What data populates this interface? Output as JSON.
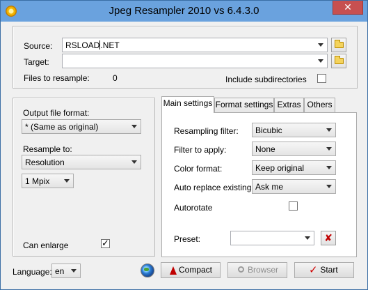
{
  "window": {
    "title": "Jpeg Resampler 2010 vs 6.4.3.0",
    "close_glyph": "✕",
    "app_icon": "sun-gear-icon"
  },
  "files": {
    "source_label": "Source:",
    "source_value": "RSLOAD",
    "source_value_rest": ".NET",
    "target_label": "Target:",
    "target_value": "",
    "files_to_resample_label": "Files to resample:",
    "files_to_resample_count": "0",
    "include_subdirs_label": "Include subdirectories",
    "include_subdirs_checked": false
  },
  "output": {
    "format_label": "Output file format:",
    "format_value": "* (Same as original)",
    "resample_to_label": "Resample to:",
    "resample_to_value": "Resolution",
    "size_value": "1 Mpix",
    "can_enlarge_label": "Can enlarge",
    "can_enlarge_checked": true
  },
  "tabs": [
    {
      "label": "Main settings",
      "active": true
    },
    {
      "label": "Format settings",
      "active": false
    },
    {
      "label": "Extras",
      "active": false
    },
    {
      "label": "Others",
      "active": false
    }
  ],
  "main_settings": {
    "resampling_filter_label": "Resampling filter:",
    "resampling_filter_value": "Bicubic",
    "filter_to_apply_label": "Filter to apply:",
    "filter_to_apply_value": "None",
    "color_format_label": "Color format:",
    "color_format_value": "Keep original",
    "auto_replace_label": "Auto replace existing:",
    "auto_replace_value": "Ask me",
    "autorotate_label": "Autorotate",
    "autorotate_checked": false,
    "preset_label": "Preset:",
    "preset_value": ""
  },
  "footer": {
    "language_label": "Language:",
    "language_value": "en",
    "compact_label": "Compact",
    "browser_label": "Browser",
    "start_label": "Start"
  },
  "colors": {
    "title_bar": "#6aa2de",
    "close_button": "#c75050",
    "window_border": "#3a6ea5"
  }
}
